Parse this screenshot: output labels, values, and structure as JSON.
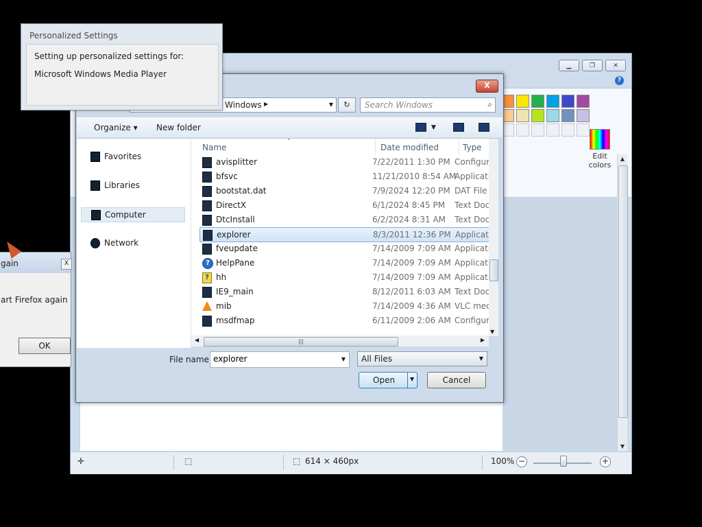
{
  "paint": {
    "help": "?",
    "edit_colors": "Edit\ncolors",
    "edit_colors_line1": "Edit",
    "edit_colors_line2": "colors",
    "palette": [
      "#ff8f3c",
      "#ffe600",
      "#22b14c",
      "#00a2e8",
      "#3f48cc",
      "#a349a4",
      "#ffc890",
      "#efe4b0",
      "#b5e61d",
      "#99d9ea",
      "#7092be",
      "#c8bfe7"
    ],
    "status": {
      "size": "614 × 460px",
      "zoom": "100%",
      "zoom_out": "−",
      "zoom_in": "+"
    }
  },
  "firefox_dialog": {
    "title": "gain",
    "close": "X",
    "message": "art Firefox again",
    "ok": "OK"
  },
  "open_dialog": {
    "close": "X",
    "address": "Windows",
    "search_placeholder": "Search Windows",
    "toolbar": {
      "organize": "Organize ▾",
      "new_folder": "New folder"
    },
    "nav": [
      "Favorites",
      "Libraries",
      "Computer",
      "Network"
    ],
    "columns": {
      "name": "Name",
      "date": "Date modified",
      "type": "Type"
    },
    "files": [
      {
        "name": "avisplitter",
        "date": "7/22/2011 1:30 PM",
        "type": "Configuration"
      },
      {
        "name": "bfsvc",
        "date": "11/21/2010 8:54 AM",
        "type": "Application"
      },
      {
        "name": "bootstat.dat",
        "date": "7/9/2024 12:20 PM",
        "type": "DAT File"
      },
      {
        "name": "DirectX",
        "date": "6/1/2024 8:45 PM",
        "type": "Text Document"
      },
      {
        "name": "DtcInstall",
        "date": "6/2/2024 8:31 AM",
        "type": "Text Document"
      },
      {
        "name": "explorer",
        "date": "8/3/2011 12:36 PM",
        "type": "Application"
      },
      {
        "name": "fveupdate",
        "date": "7/14/2009 7:09 AM",
        "type": "Application"
      },
      {
        "name": "HelpPane",
        "date": "7/14/2009 7:09 AM",
        "type": "Application"
      },
      {
        "name": "hh",
        "date": "7/14/2009 7:09 AM",
        "type": "Application"
      },
      {
        "name": "IE9_main",
        "date": "8/12/2011 6:03 AM",
        "type": "Text Document"
      },
      {
        "name": "mib",
        "date": "7/14/2009 4:36 AM",
        "type": "VLC media file"
      },
      {
        "name": "msdfmap",
        "date": "6/11/2009 2:06 AM",
        "type": "Configuration"
      }
    ],
    "file_name_label": "File name:",
    "file_name_value": "explorer",
    "filter": "All Files",
    "open": "Open",
    "cancel": "Cancel"
  },
  "personalized": {
    "title": "Personalized Settings",
    "line1": "Setting up personalized settings for:",
    "line2": "Microsoft Windows Media Player"
  }
}
